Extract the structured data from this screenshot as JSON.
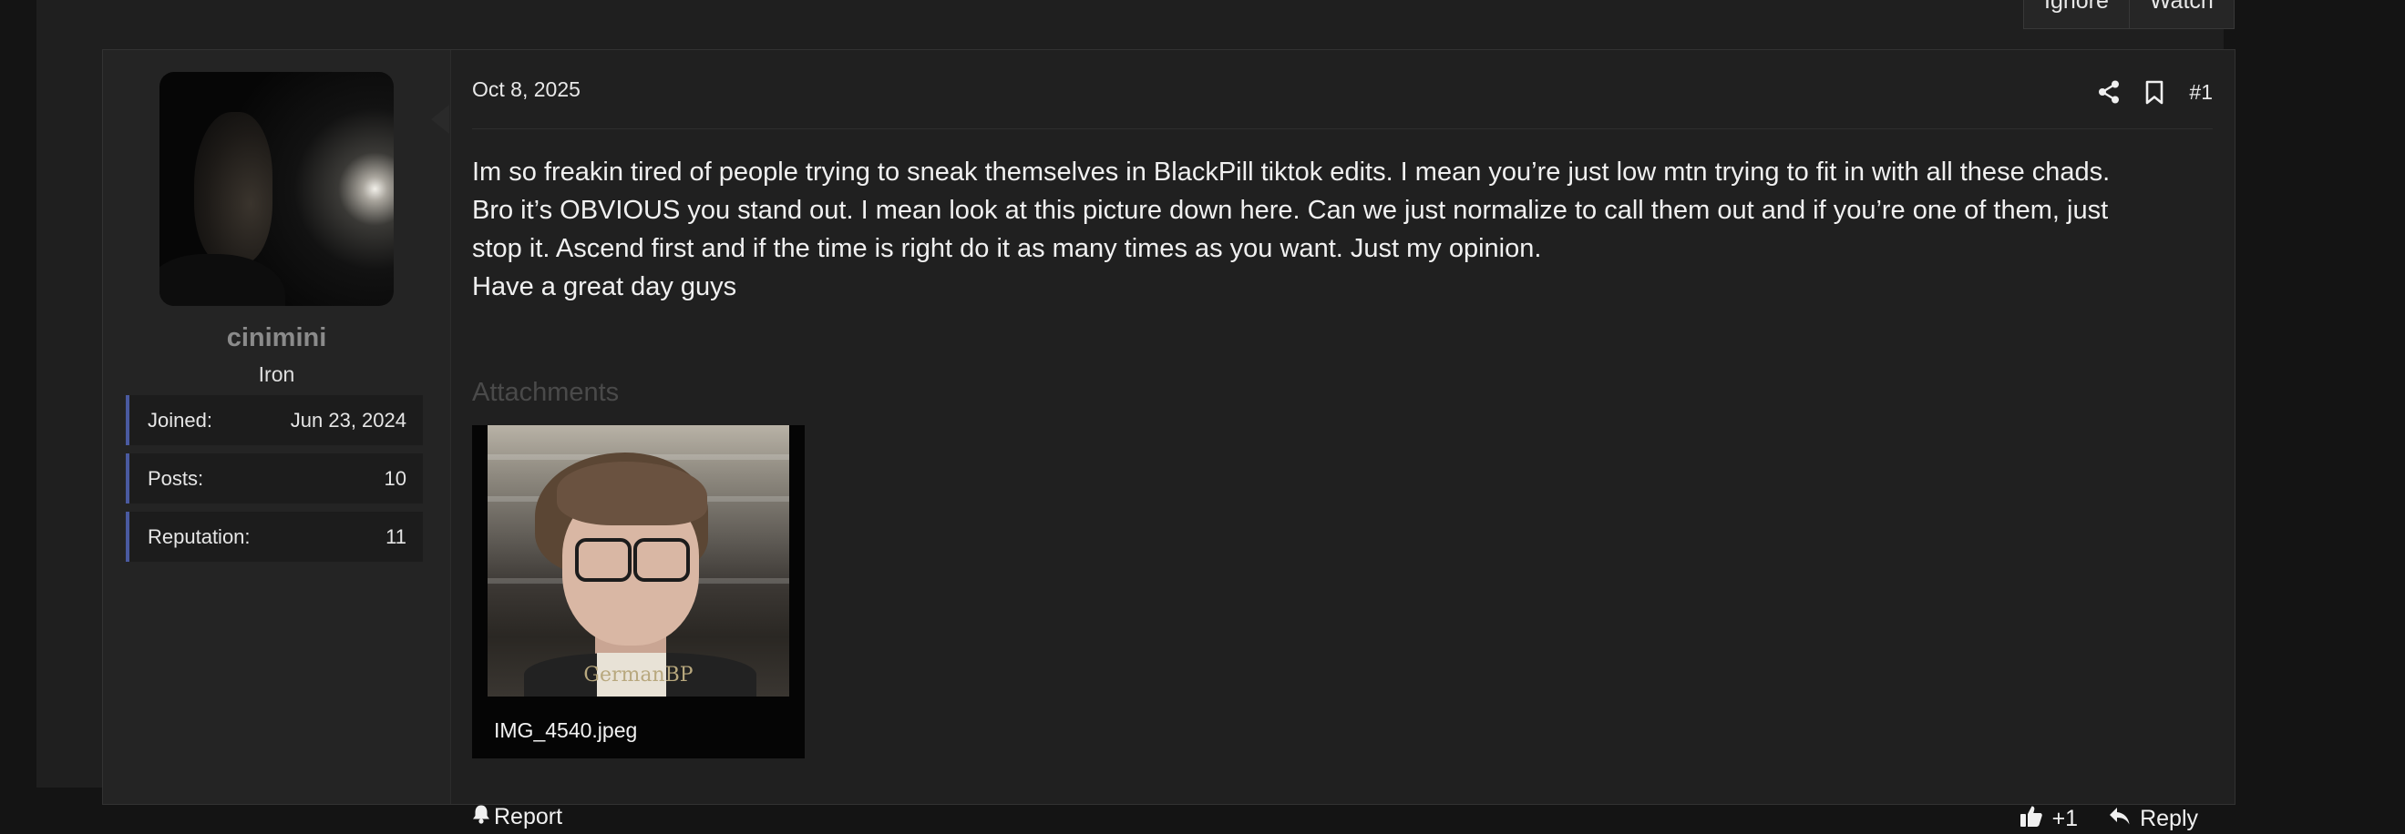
{
  "thread_buttons": {
    "ignore": "Ignore",
    "watch": "Watch"
  },
  "post": {
    "date": "Oct 8, 2025",
    "number": "#1",
    "author": {
      "username": "cinimini",
      "title": "Iron",
      "stats": [
        {
          "label": "Joined:",
          "value": "Jun 23, 2024"
        },
        {
          "label": "Posts:",
          "value": "10"
        },
        {
          "label": "Reputation:",
          "value": "11"
        }
      ]
    },
    "body_lines": [
      "Im so freakin tired of people trying to sneak themselves in BlackPill tiktok edits. I mean you’re just low mtn trying to fit in with all these chads.",
      "Bro it’s OBVIOUS you stand out. I mean look at this picture down here. Can we just normalize to call them out and if you’re one of them, just",
      "stop it. Ascend first and if the time is right do it as many times as you want. Just my opinion.",
      "Have a great day guys"
    ],
    "attachments_title": "Attachments",
    "attachment": {
      "filename": "IMG_4540.jpeg",
      "watermark": "GermanBP"
    },
    "footer": {
      "report": "Report",
      "reaction_count": "+1",
      "reply": "Reply"
    }
  },
  "icons": {
    "share": "share-icon",
    "bookmark": "bookmark-icon",
    "report": "bell-icon",
    "like": "thumbs-up-icon",
    "reply": "reply-arrow-icon"
  },
  "colors": {
    "background": "#1f1f1f",
    "user_stat_accent": "#4a5aa0",
    "username": "#8b8b8b"
  }
}
